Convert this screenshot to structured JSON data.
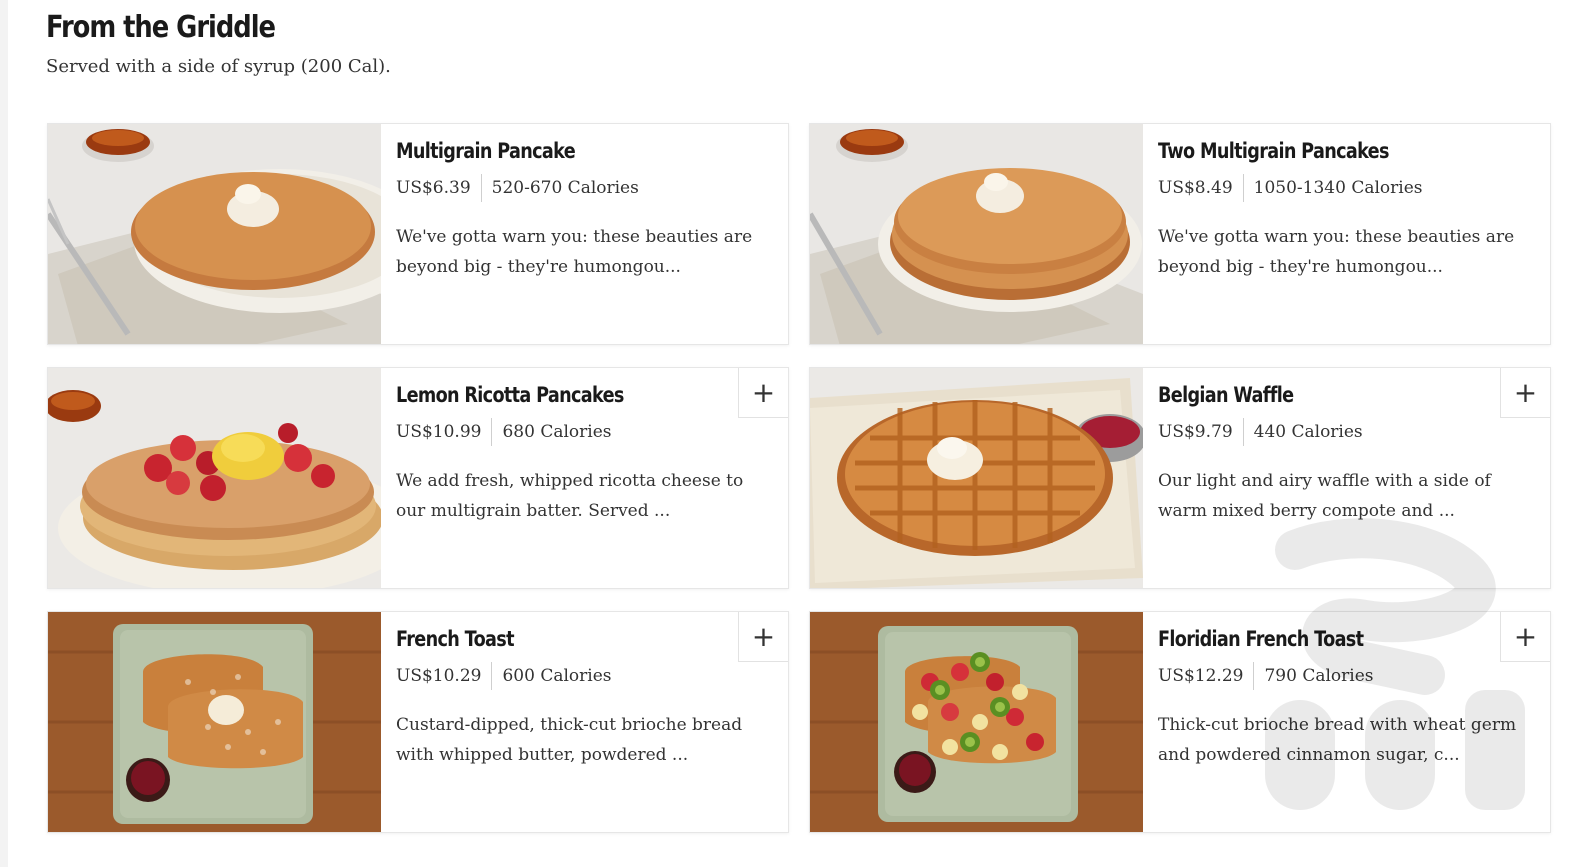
{
  "section": {
    "title": "From the Griddle",
    "subtitle": "Served with a side of syrup (200 Cal)."
  },
  "add_icon": "plus-icon",
  "items": [
    {
      "name": "Multigrain Pancake",
      "price": "US$6.39",
      "calories": "520-670 Calories",
      "description": "We've gotta warn you: these beauties are beyond big - they're humongou...",
      "photo": "pancake-single"
    },
    {
      "name": "Two Multigrain Pancakes",
      "price": "US$8.49",
      "calories": "1050-1340 Calories",
      "description": "We've gotta warn you: these beauties are beyond big - they're humongou...",
      "photo": "pancake-double"
    },
    {
      "name": "Lemon Ricotta Pancakes",
      "price": "US$10.99",
      "calories": "680 Calories",
      "description": "We add fresh, whipped ricotta cheese to our multigrain batter. Served ...",
      "photo": "lemon-ricotta-pancakes",
      "add_label": "+"
    },
    {
      "name": "Belgian Waffle",
      "price": "US$9.79",
      "calories": "440 Calories",
      "description": "Our light and airy waffle with a side of warm mixed berry compote and ...",
      "photo": "belgian-waffle",
      "add_label": "+"
    },
    {
      "name": "French Toast",
      "price": "US$10.29",
      "calories": "600 Calories",
      "description": "Custard-dipped, thick-cut brioche bread with whipped butter, powdered ...",
      "photo": "french-toast",
      "add_label": "+"
    },
    {
      "name": "Floridian French Toast",
      "price": "US$12.29",
      "calories": "790 Calories",
      "description": "Thick-cut brioche bread with wheat germ and powdered cinnamon sugar, c...",
      "photo": "floridian-french-toast",
      "add_label": "+"
    }
  ],
  "colors": {
    "text": "#2b2b2b",
    "title": "#1a1a1a",
    "border": "#e6e6e6"
  }
}
